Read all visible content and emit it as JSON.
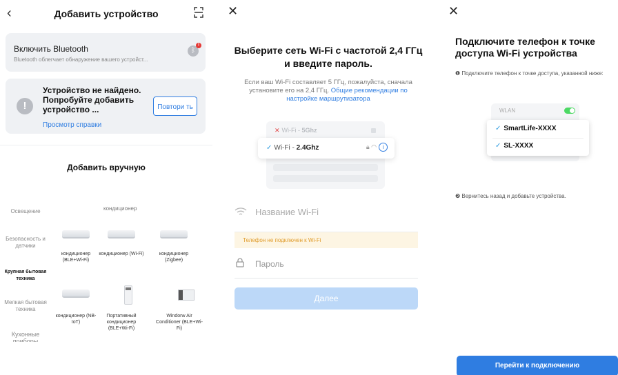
{
  "screen1": {
    "title": "Добавить устройство",
    "back_icon": "chevron-left-icon",
    "scan_icon": "scan-icon",
    "bluetooth": {
      "title": "Включить Bluetooth",
      "subtitle": "Bluetooth облегчает обнаружение вашего устройст...",
      "badge": "!"
    },
    "not_found": {
      "message": "Устройство не найдено. Попробуйте добавить устройство ...",
      "retry_label": "Повтори ть",
      "help_link": "Просмотр справки"
    },
    "manual_title": "Добавить вручную",
    "categories": [
      "Освещение",
      "Безопасность и датчики",
      "Крупная бытовая техника",
      "Мелкая бытовая техника",
      "Кухонные приборы"
    ],
    "active_category": "Крупная бытовая техника",
    "group_title": "кондиционер",
    "devices": [
      {
        "label": "кондиционер (BLE+Wi-Fi)",
        "icon": "split-ac-icon"
      },
      {
        "label": "кондиционер (Wi-Fi)",
        "icon": "split-ac-icon"
      },
      {
        "label": "кондиционер (Zigbee)",
        "icon": "split-ac-icon"
      },
      {
        "label": "кондиционер (NB-IoT)",
        "icon": "split-ac-icon"
      },
      {
        "label": "Портативный кондиционер (BLE+Wi-Fi)",
        "icon": "portable-ac-icon"
      },
      {
        "label": "Windorw Air Conditioner (BLE+Wi-Fi)",
        "icon": "window-ac-icon"
      }
    ]
  },
  "screen2": {
    "close_icon": "close-icon",
    "title": "Выберите сеть Wi-Fi с частотой 2,4 ГГц и введите пароль.",
    "desc": "Если ваш Wi-Fi составляет 5 ГГц, пожалуйста, сначала установите его на 2,4 ГГц.",
    "desc_link": "Общие рекомендации по настройке маршрутизатора",
    "wifi_bad_prefix": "Wi-Fi - ",
    "wifi_bad": "5Ghz",
    "wifi_good_prefix": "Wi-Fi - ",
    "wifi_good": "2.4Ghz",
    "wifi_name_placeholder": "Название Wi-Fi",
    "warning": "Телефон не подключен к Wi-Fi",
    "password_placeholder": "Пароль",
    "next_label": "Далее"
  },
  "screen3": {
    "close_icon": "close-icon",
    "title": "Подключите телефон к точке доступа Wi-Fi устройства",
    "step1": "❶ Подключите телефон к точке доступа, указанной ниже:",
    "wlan_label": "WLAN",
    "ssids": [
      "SmartLife-XXXX",
      "SL-XXXX"
    ],
    "step2": "❷ Вернитесь назад и добавьте устройства.",
    "go_label": "Перейти к подключению"
  },
  "colors": {
    "accent": "#2f7de1",
    "accent_disabled": "#bcd8f8",
    "warning": "#e09b2a",
    "card": "#eff1f4"
  }
}
